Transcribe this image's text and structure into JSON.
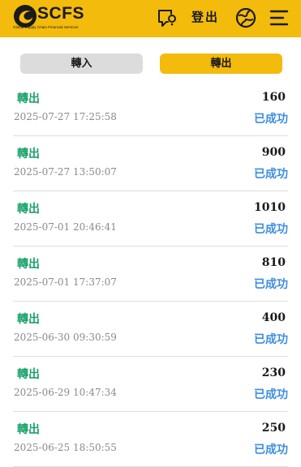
{
  "header": {
    "brand": "SCFS",
    "tagline": "Global Supply Chain Financial Services",
    "logout_label": "登出",
    "icons": {
      "message": "message-question-icon",
      "language": "globe-icon",
      "menu": "menu-icon"
    }
  },
  "tabs": [
    {
      "label": "轉入",
      "active": false
    },
    {
      "label": "轉出",
      "active": true
    }
  ],
  "records": [
    {
      "type": "轉出",
      "time": "2025-07-27 17:25:58",
      "amount": "160",
      "status": "已成功"
    },
    {
      "type": "轉出",
      "time": "2025-07-27 13:50:07",
      "amount": "900",
      "status": "已成功"
    },
    {
      "type": "轉出",
      "time": "2025-07-01 20:46:41",
      "amount": "1010",
      "status": "已成功"
    },
    {
      "type": "轉出",
      "time": "2025-07-01 17:37:07",
      "amount": "810",
      "status": "已成功"
    },
    {
      "type": "轉出",
      "time": "2025-06-30 09:30:59",
      "amount": "400",
      "status": "已成功"
    },
    {
      "type": "轉出",
      "time": "2025-06-29 10:47:34",
      "amount": "230",
      "status": "已成功"
    },
    {
      "type": "轉出",
      "time": "2025-06-25 18:50:55",
      "amount": "250",
      "status": "已成功"
    }
  ],
  "colors": {
    "brand_yellow": "#f3bb0b",
    "type_green": "#1aa36a",
    "status_blue": "#3d8ee0",
    "tab_inactive": "#dcdcdc"
  }
}
